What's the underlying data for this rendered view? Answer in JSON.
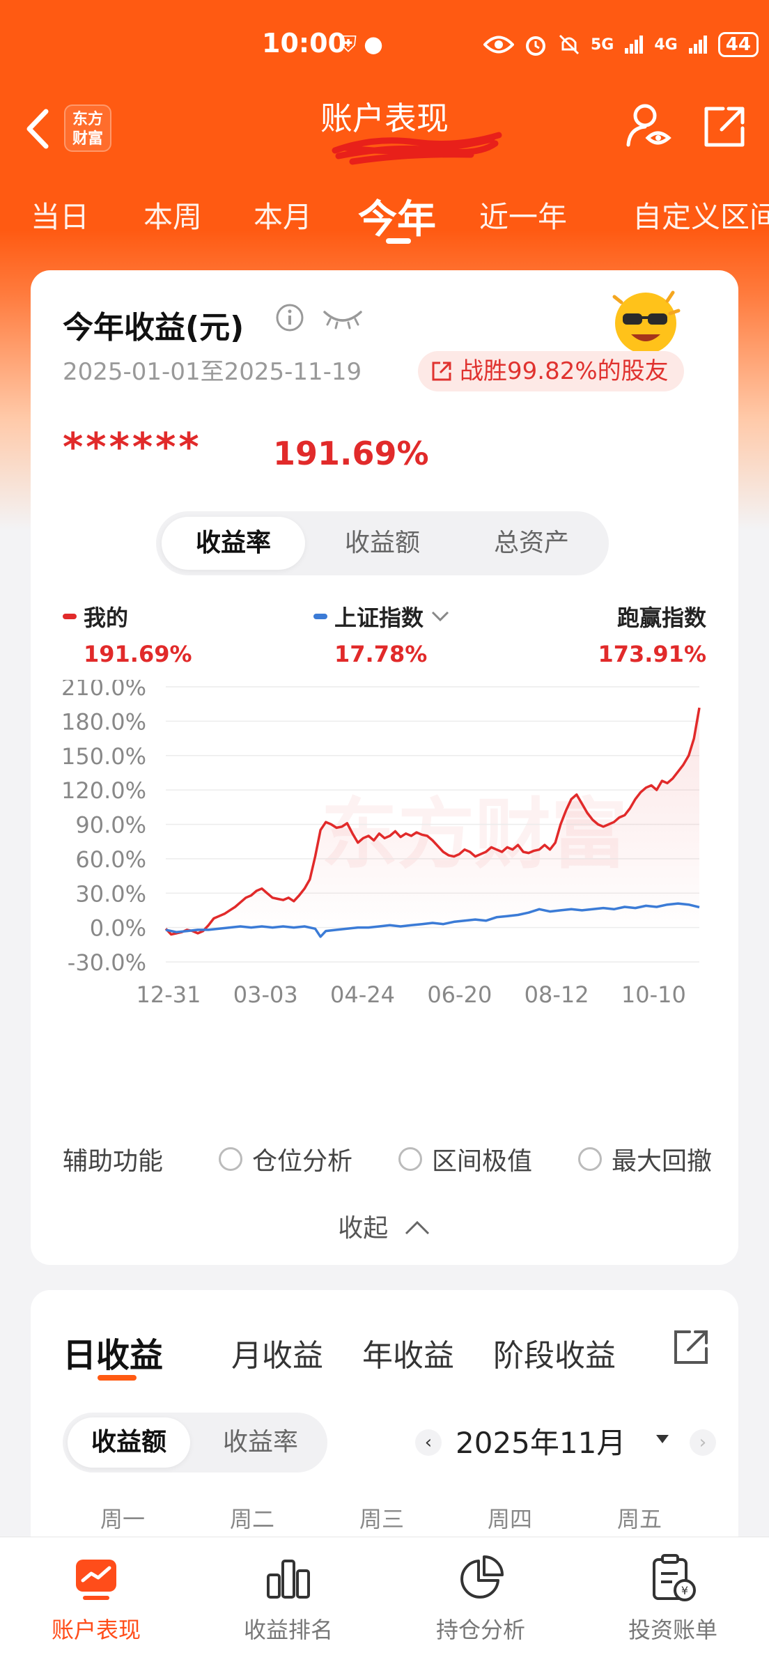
{
  "status_bar": {
    "time": "10:00",
    "left_icons": "⛨ ●",
    "signal_1": "5G",
    "signal_2": "4G",
    "battery": "44"
  },
  "header": {
    "title": "账户表现",
    "logo_line1": "东方",
    "logo_line2": "财富"
  },
  "period_tabs": [
    "当日",
    "本周",
    "本月",
    "今年",
    "近一年",
    "自定义区间"
  ],
  "active_period": "今年",
  "summary": {
    "title": "今年收益(元)",
    "date_range": "2025-01-01至2025-11-19",
    "beat_text": "战胜99.82%的股友",
    "hidden_amount": "******",
    "return_pct": "191.69%"
  },
  "metric_tabs": [
    "收益率",
    "收益额",
    "总资产"
  ],
  "active_metric": "收益率",
  "legend": {
    "mine": {
      "label": "我的",
      "value": "191.69%",
      "color": "#e12a2a"
    },
    "index": {
      "label": "上证指数",
      "value": "17.78%",
      "color": "#3b7bd6"
    },
    "beat_index": {
      "label": "跑赢指数",
      "value": "173.91%"
    }
  },
  "chart_data": {
    "type": "line",
    "x_labels": [
      "12-31",
      "03-03",
      "04-24",
      "06-20",
      "08-12",
      "10-10"
    ],
    "y_ticks": [
      "210.0%",
      "180.0%",
      "150.0%",
      "120.0%",
      "90.0%",
      "60.0%",
      "30.0%",
      "0.0%",
      "-30.0%"
    ],
    "ylim": [
      -30,
      210
    ],
    "grid": true,
    "x_index_range": [
      0,
      100
    ],
    "watermark": "东方财富",
    "series": [
      {
        "name": "我的",
        "color": "#e12a2a",
        "x": [
          0,
          1,
          2,
          3,
          4,
          5,
          6,
          7,
          8,
          9,
          10,
          11,
          12,
          13,
          14,
          15,
          16,
          17,
          18,
          19,
          20,
          21,
          22,
          23,
          24,
          25,
          26,
          27,
          28,
          29,
          30,
          31,
          32,
          33,
          34,
          35,
          36,
          37,
          38,
          39,
          40,
          41,
          42,
          43,
          44,
          45,
          46,
          47,
          48,
          49,
          50,
          51,
          52,
          53,
          54,
          55,
          56,
          57,
          58,
          59,
          60,
          61,
          62,
          63,
          64,
          65,
          66,
          67,
          68,
          69,
          70,
          71,
          72,
          73,
          74,
          75,
          76,
          77,
          78,
          79,
          80,
          81,
          82,
          83,
          84,
          85,
          86,
          87,
          88,
          89,
          90,
          91,
          92,
          93,
          94,
          95,
          96,
          97,
          98,
          99,
          100
        ],
        "y": [
          -1,
          -6,
          -5,
          -4,
          -2,
          -3,
          -5,
          -3,
          2,
          8,
          10,
          12,
          15,
          18,
          22,
          26,
          28,
          32,
          34,
          30,
          26,
          25,
          24,
          26,
          23,
          28,
          34,
          42,
          62,
          85,
          92,
          90,
          87,
          88,
          91,
          82,
          74,
          78,
          80,
          76,
          82,
          78,
          80,
          84,
          79,
          82,
          80,
          83,
          81,
          80,
          76,
          71,
          66,
          63,
          62,
          64,
          68,
          66,
          62,
          64,
          66,
          70,
          68,
          66,
          70,
          68,
          72,
          66,
          65,
          67,
          68,
          72,
          68,
          74,
          90,
          102,
          112,
          116,
          108,
          100,
          94,
          90,
          88,
          90,
          92,
          96,
          98,
          104,
          112,
          118,
          122,
          124,
          120,
          128,
          126,
          130,
          136,
          142,
          150,
          165,
          191.69
        ]
      },
      {
        "name": "上证指数",
        "color": "#3b7bd6",
        "x": [
          0,
          2,
          4,
          6,
          8,
          10,
          12,
          14,
          16,
          18,
          20,
          22,
          24,
          26,
          28,
          29,
          30,
          32,
          34,
          36,
          38,
          40,
          42,
          44,
          46,
          48,
          50,
          52,
          54,
          56,
          58,
          60,
          62,
          64,
          66,
          68,
          70,
          72,
          74,
          76,
          78,
          80,
          82,
          84,
          86,
          88,
          90,
          92,
          94,
          96,
          98,
          100
        ],
        "y": [
          -2,
          -4,
          -3,
          -2,
          -2,
          -1,
          0,
          1,
          0,
          1,
          0,
          1,
          0,
          1,
          -1,
          -8,
          -3,
          -2,
          -1,
          0,
          0,
          1,
          2,
          1,
          2,
          3,
          4,
          3,
          5,
          6,
          7,
          6,
          9,
          10,
          11,
          13,
          16,
          14,
          15,
          16,
          15,
          16,
          17,
          16,
          18,
          17,
          19,
          18,
          20,
          21,
          20,
          17.78
        ]
      }
    ]
  },
  "aux": {
    "label": "辅助功能",
    "options": [
      "仓位分析",
      "区间极值",
      "最大回撤"
    ]
  },
  "collapse_label": "收起",
  "returns_card": {
    "tabs": [
      "日收益",
      "月收益",
      "年收益",
      "阶段收益"
    ],
    "active_tab": "日收益",
    "toggle": [
      "收益额",
      "收益率"
    ],
    "active_toggle": "收益额",
    "month": "2025年11月",
    "weekdays": [
      "周一",
      "周二",
      "周三",
      "周四",
      "周五"
    ]
  },
  "bottom_nav": [
    {
      "label": "账户表现",
      "icon": "trend-chart-icon",
      "active": true
    },
    {
      "label": "收益排名",
      "icon": "bar-chart-icon",
      "active": false
    },
    {
      "label": "持仓分析",
      "icon": "pie-chart-icon",
      "active": false
    },
    {
      "label": "投资账单",
      "icon": "bill-icon",
      "active": false
    }
  ]
}
